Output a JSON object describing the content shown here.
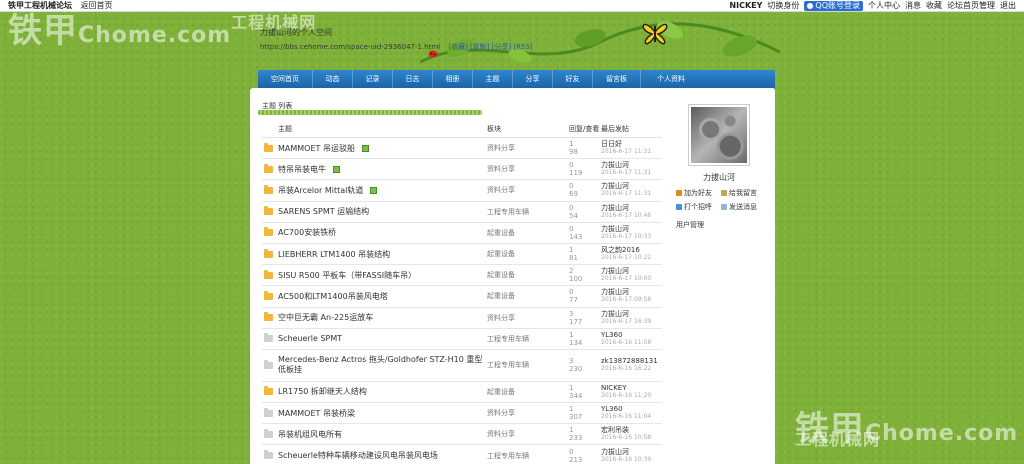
{
  "topbar": {
    "site": "铁甲工程机械论坛",
    "home": "返回首页",
    "user": "NICKEY",
    "switch_user": "切换身份",
    "qq": "QQ账号登录",
    "links": [
      "个人中心",
      "消息",
      "收藏",
      "论坛首页管理",
      "退出"
    ]
  },
  "watermark": {
    "cn": "铁甲",
    "small": "工程机械网",
    "url": "Chome.com"
  },
  "header": {
    "title": "力拔山河的个人空间",
    "url": "https://bbs.cehome.com/space-uid-2936047-1.html",
    "url_links": "[收藏] [复制] [分享] [RSS]"
  },
  "nav": [
    "空间首页",
    "动态",
    "记录",
    "日志",
    "相册",
    "主题",
    "分享",
    "好友",
    "留言板",
    "个人资料"
  ],
  "breadcrumb": "主题  列表",
  "table": {
    "headers": {
      "title": "主题",
      "board": "板块",
      "reply": "回复/查看",
      "last": "最后发帖"
    },
    "rows": [
      {
        "title": "MAMMOET 吊运驳船",
        "pic": true,
        "folder": "gold",
        "board": "资料分享",
        "replies": "1",
        "views": "98",
        "who": "日日好",
        "when": "2016-6-17 11:31"
      },
      {
        "title": "特吊吊装电牛",
        "pic": true,
        "folder": "gold",
        "board": "资料分享",
        "replies": "0",
        "views": "119",
        "who": "力拔山河",
        "when": "2016-6-17 11:31"
      },
      {
        "title": "吊装Arcelor Mittal轨道",
        "pic": true,
        "folder": "gold",
        "board": "资料分享",
        "replies": "0",
        "views": "69",
        "who": "力拔山河",
        "when": "2016-6-17 11:31"
      },
      {
        "title": "SARENS SPMT 运输结构",
        "pic": false,
        "folder": "gold",
        "board": "工程专用车辆",
        "replies": "0",
        "views": "54",
        "who": "力拔山河",
        "when": "2016-6-17 10:46"
      },
      {
        "title": "AC700安装铁桥",
        "pic": false,
        "folder": "gold",
        "board": "起重设备",
        "replies": "0",
        "views": "143",
        "who": "力拔山河",
        "when": "2016-6-17 10:33"
      },
      {
        "title": "LIEBHERR LTM1400 吊装结构",
        "pic": false,
        "folder": "gold",
        "board": "起重设备",
        "replies": "1",
        "views": "81",
        "who": "风之韵2016",
        "when": "2016-6-17 10:22"
      },
      {
        "title": "SISU R500 平板车（带FASSI随车吊）",
        "pic": false,
        "folder": "gold",
        "board": "起重设备",
        "replies": "2",
        "views": "100",
        "who": "力拔山河",
        "when": "2016-6-17 10:00"
      },
      {
        "title": "AC500和LTM1400吊装风电塔",
        "pic": false,
        "folder": "gold",
        "board": "起重设备",
        "replies": "0",
        "views": "77",
        "who": "力拔山河",
        "when": "2016-6-17 09:58"
      },
      {
        "title": "空中巨无霸 An-225运放车",
        "pic": false,
        "folder": "gold",
        "board": "资料分享",
        "replies": "3",
        "views": "177",
        "who": "力拔山河",
        "when": "2016-6-17 16:39"
      },
      {
        "title": "Scheuerle SPMT",
        "pic": false,
        "folder": "gray",
        "board": "工程专用车辆",
        "replies": "1",
        "views": "134",
        "who": "YL360",
        "when": "2016-6-16 11:58"
      },
      {
        "title": "Mercedes-Benz Actros 拖头/Goldhofer STZ-H10 重型低板挂",
        "pic": false,
        "folder": "gray",
        "board": "工程专用车辆",
        "replies": "3",
        "views": "230",
        "who": "zk13872888131",
        "when": "2016-6-16 16:22",
        "tall": true
      },
      {
        "title": "LR1750 拆卸继天人结构",
        "pic": false,
        "folder": "gold",
        "board": "起重设备",
        "replies": "1",
        "views": "344",
        "who": "NICKEY",
        "when": "2016-6-16 11:20"
      },
      {
        "title": "MAMMOET 吊装桥梁",
        "pic": false,
        "folder": "gray",
        "board": "资料分享",
        "replies": "1",
        "views": "307",
        "who": "YL360",
        "when": "2016-6-16 11:04"
      },
      {
        "title": "吊装机组风电所有",
        "pic": false,
        "folder": "gray",
        "board": "资料分享",
        "replies": "1",
        "views": "233",
        "who": "宏利吊装",
        "when": "2016-6-16 10:58"
      },
      {
        "title": "Scheuerle特种车辆移动建设风电吊装风电场",
        "pic": false,
        "folder": "gray",
        "board": "工程专用车辆",
        "replies": "0",
        "views": "213",
        "who": "力拔山河",
        "when": "2016-6-16 10:39"
      }
    ]
  },
  "sidebar": {
    "name": "力拔山河",
    "actions": [
      "加为好友",
      "给我留言",
      "打个招呼",
      "发送消息"
    ],
    "manage": "用户管理"
  },
  "colors": {
    "nav": "#1f6fb8",
    "bg": "#7fb13a",
    "folder": "#f2b73a"
  }
}
